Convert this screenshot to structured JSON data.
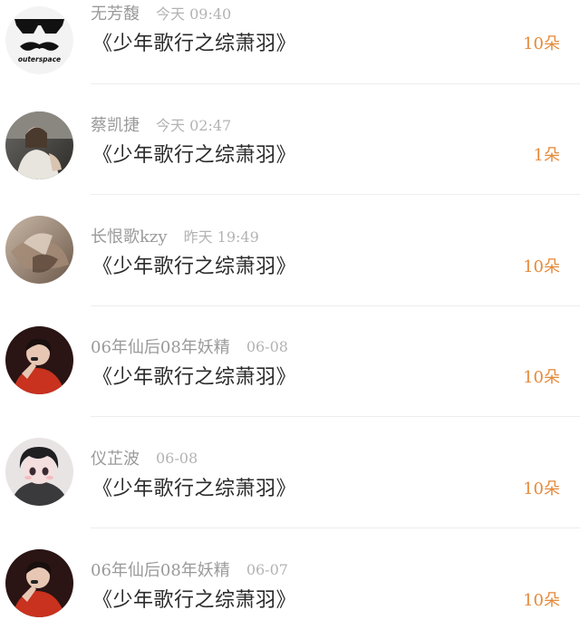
{
  "comments": [
    {
      "user": "无芳馥",
      "time": "今天 09:40",
      "title": "《少年歌行之综萧羽》",
      "count": "10朵",
      "avatar": "outerspace-sunglasses-mustache-avatar",
      "avatar_text": "outerspace"
    },
    {
      "user": "蔡凯捷",
      "time": "今天 02:47",
      "title": "《少年歌行之综萧羽》",
      "count": "1朵",
      "avatar": "photo-person-avatar"
    },
    {
      "user": "长恨歌kzy",
      "time": "昨天 19:49",
      "title": "《少年歌行之综萧羽》",
      "count": "10朵",
      "avatar": "photo-abstract-avatar"
    },
    {
      "user": "06年仙后08年妖精",
      "time": "06-08",
      "title": "《少年歌行之综萧羽》",
      "count": "10朵",
      "avatar": "photo-singer-red-avatar"
    },
    {
      "user": "仪芷波",
      "time": "06-08",
      "title": "《少年歌行之综萧羽》",
      "count": "10朵",
      "avatar": "anime-character-avatar"
    },
    {
      "user": "06年仙后08年妖精",
      "time": "06-07",
      "title": "《少年歌行之综萧羽》",
      "count": "10朵",
      "avatar": "photo-singer-red-avatar"
    }
  ],
  "colors": {
    "name": "#9a9a9a",
    "time": "#b3b3b3",
    "title": "#2b2b2b",
    "count": "#e58a3a",
    "divider": "#ededed"
  }
}
